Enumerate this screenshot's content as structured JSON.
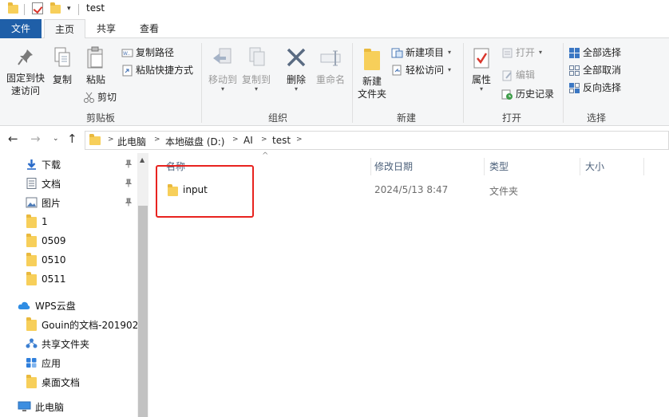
{
  "window": {
    "title": "test"
  },
  "tabs": [
    {
      "label": "文件"
    },
    {
      "label": "主页"
    },
    {
      "label": "共享"
    },
    {
      "label": "查看"
    }
  ],
  "ribbon": {
    "clipboard": {
      "label": "剪贴板",
      "pin_quick_access": "固定到快速访问",
      "copy": "复制",
      "paste": "粘贴",
      "copy_path": "复制路径",
      "paste_shortcut": "粘贴快捷方式",
      "cut": "剪切"
    },
    "organize": {
      "label": "组织",
      "move_to": "移动到",
      "copy_to": "复制到",
      "delete": "删除",
      "rename": "重命名"
    },
    "new": {
      "label": "新建",
      "new_folder": "新建\n文件夹",
      "new_item": "新建项目",
      "easy_access": "轻松访问"
    },
    "open": {
      "label": "打开",
      "properties": "属性",
      "open": "打开",
      "edit": "编辑",
      "history": "历史记录"
    },
    "select": {
      "label": "选择",
      "select_all": "全部选择",
      "select_none": "全部取消",
      "invert": "反向选择"
    }
  },
  "address": {
    "crumbs": [
      "此电脑",
      "本地磁盘 (D:)",
      "AI",
      "test"
    ]
  },
  "navpane": {
    "items": [
      {
        "label": "下载",
        "icon": "download-icon",
        "pinned": true
      },
      {
        "label": "文档",
        "icon": "document-icon",
        "pinned": true
      },
      {
        "label": "图片",
        "icon": "picture-icon",
        "pinned": true
      },
      {
        "label": "1",
        "icon": "folder-icon"
      },
      {
        "label": "0509",
        "icon": "folder-icon"
      },
      {
        "label": "0510",
        "icon": "folder-icon"
      },
      {
        "label": "0511",
        "icon": "folder-icon"
      },
      {
        "label": "WPS云盘",
        "icon": "cloud-icon"
      },
      {
        "label": "Gouin的文档-201902",
        "icon": "folder-icon"
      },
      {
        "label": "共享文件夹",
        "icon": "share-icon"
      },
      {
        "label": "应用",
        "icon": "apps-icon"
      },
      {
        "label": "桌面文档",
        "icon": "folder-icon"
      },
      {
        "label": "此电脑",
        "icon": "computer-icon"
      }
    ]
  },
  "filelist": {
    "columns": {
      "name": "名称",
      "modified": "修改日期",
      "type": "类型",
      "size": "大小"
    },
    "rows": [
      {
        "name": "input",
        "modified": "2024/5/13 8:47",
        "type": "文件夹",
        "size": ""
      }
    ]
  },
  "colors": {
    "file_tab": "#1f5fa8",
    "folder": "#f7cf5a",
    "highlight": "#e8231f"
  }
}
